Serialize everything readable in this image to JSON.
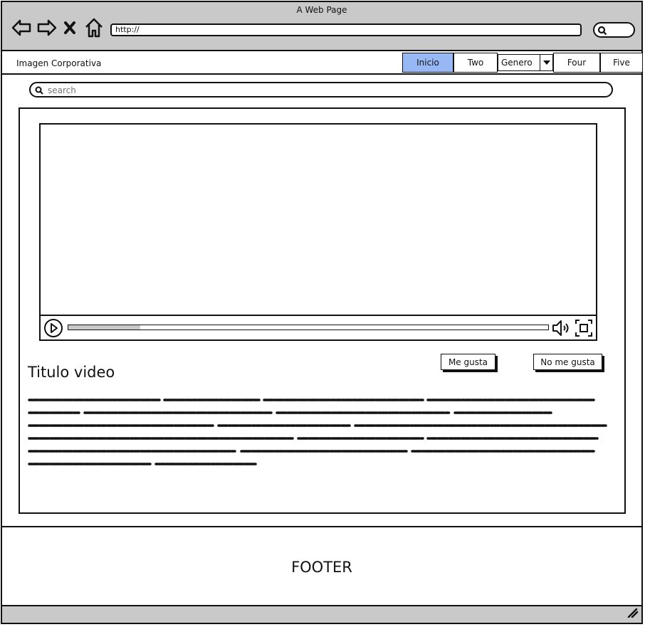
{
  "browser": {
    "title": "A Web Page",
    "url": "http://",
    "icons": [
      "back-arrow-icon",
      "forward-arrow-icon",
      "close-x-icon",
      "home-icon",
      "search-icon"
    ]
  },
  "header": {
    "brand": "Imagen Corporativa",
    "tabs": [
      {
        "label": "Inicio",
        "active": true
      },
      {
        "label": "Two",
        "active": false
      },
      {
        "label": "Four",
        "active": false
      },
      {
        "label": "Five",
        "active": false
      }
    ],
    "dropdown": {
      "selected": "Genero"
    }
  },
  "search": {
    "placeholder": "search"
  },
  "video": {
    "progress": 0.15,
    "icons": [
      "play-icon",
      "volume-icon",
      "fullscreen-icon"
    ]
  },
  "actions": {
    "like": "Me gusta",
    "dislike": "No me gusta"
  },
  "content": {
    "title": "Titulo video"
  },
  "footer": {
    "label": "FOOTER"
  },
  "colors": {
    "active_tab": "#97b8f4",
    "chrome": "#c9c9c9",
    "border": "#111111"
  }
}
